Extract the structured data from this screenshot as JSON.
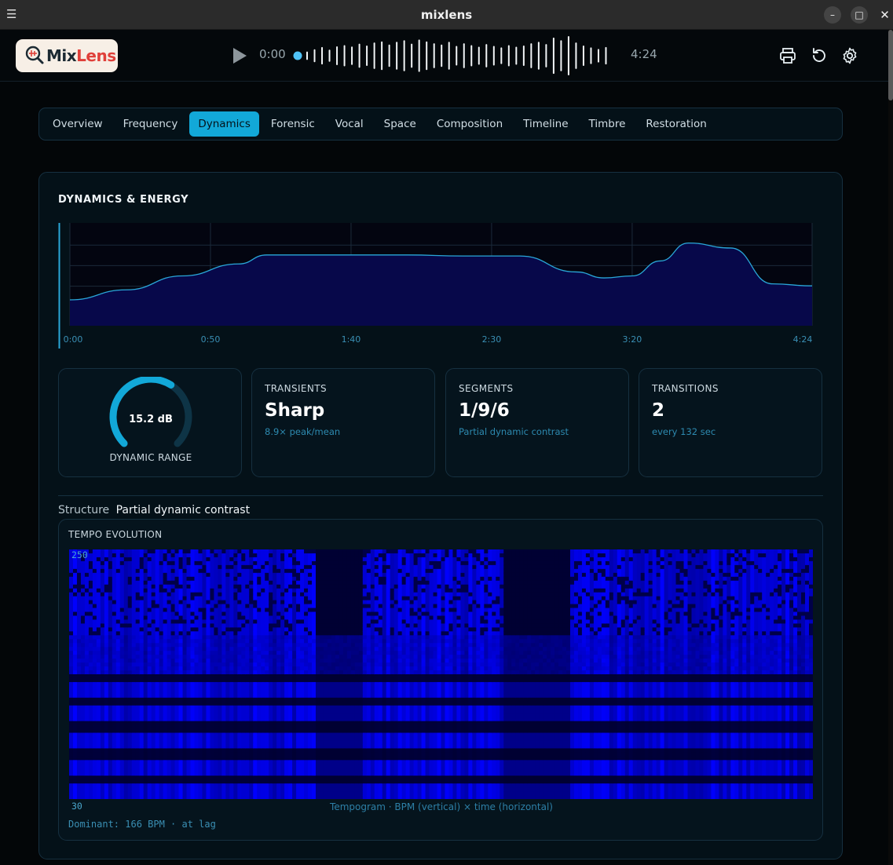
{
  "window": {
    "title": "mixlens",
    "menu_icon": "hamburger-icon",
    "min_icon": "minimize-icon",
    "max_icon": "maximize-icon",
    "close_icon": "close-icon"
  },
  "header": {
    "logo": {
      "text_a": "Mix",
      "text_b": "Lens"
    },
    "player": {
      "current_time": "0:00",
      "duration": "4:24",
      "progress": 0.0,
      "waveform_levels": [
        0.18,
        0.3,
        0.42,
        0.28,
        0.46,
        0.52,
        0.45,
        0.6,
        0.5,
        0.66,
        0.72,
        0.55,
        0.7,
        0.78,
        0.6,
        0.82,
        0.72,
        0.62,
        0.55,
        0.7,
        0.48,
        0.62,
        0.52,
        0.44,
        0.58,
        0.48,
        0.4,
        0.52,
        0.44,
        0.5,
        0.62,
        0.7,
        0.58,
        0.92,
        0.78,
        1.0,
        0.66,
        0.5,
        0.4,
        0.32,
        0.42
      ]
    },
    "actions": {
      "print_icon": "print-icon",
      "reset_icon": "reset-icon",
      "settings_icon": "gear-icon"
    }
  },
  "tabs": [
    {
      "label": "Overview",
      "active": false
    },
    {
      "label": "Frequency",
      "active": false
    },
    {
      "label": "Dynamics",
      "active": true
    },
    {
      "label": "Forensic",
      "active": false
    },
    {
      "label": "Vocal",
      "active": false
    },
    {
      "label": "Space",
      "active": false
    },
    {
      "label": "Composition",
      "active": false
    },
    {
      "label": "Timeline",
      "active": false
    },
    {
      "label": "Timbre",
      "active": false
    },
    {
      "label": "Restoration",
      "active": false
    }
  ],
  "dynamics": {
    "title": "DYNAMICS & ENERGY",
    "metrics": {
      "dynamic_range": {
        "value": "15.2 dB",
        "label": "DYNAMIC RANGE",
        "fraction": 0.62
      },
      "transients": {
        "label": "TRANSIENTS",
        "value": "Sharp",
        "sub": "8.9× peak/mean"
      },
      "segments": {
        "label": "SEGMENTS",
        "value": "1/9/6",
        "sub": "Partial dynamic contrast"
      },
      "transitions": {
        "label": "TRANSITIONS",
        "value": "2",
        "sub": "every 132 sec"
      }
    },
    "structure": {
      "key": "Structure",
      "value": "Partial dynamic contrast"
    },
    "tempo": {
      "title": "TEMPO EVOLUTION",
      "y_top": "250",
      "y_bottom": "30",
      "caption": "Tempogram · BPM (vertical) × time (horizontal)",
      "dominant": "Dominant: 166 BPM · at lag"
    }
  },
  "chart_data": {
    "type": "area",
    "x_ticks": [
      "0:00",
      "0:50",
      "1:40",
      "2:30",
      "3:20",
      "4:24"
    ],
    "x": [
      0,
      20,
      40,
      60,
      70,
      80,
      100,
      120,
      140,
      160,
      180,
      190,
      200,
      210,
      220,
      235,
      250,
      264
    ],
    "y": [
      0.26,
      0.36,
      0.5,
      0.62,
      0.71,
      0.71,
      0.71,
      0.71,
      0.7,
      0.7,
      0.54,
      0.48,
      0.5,
      0.65,
      0.83,
      0.78,
      0.42,
      0.4
    ],
    "xlim": [
      0,
      264
    ],
    "ylim": [
      0,
      1
    ],
    "grid": true,
    "colors": {
      "line": "#2aa7d8",
      "fill": "#07084a"
    }
  }
}
